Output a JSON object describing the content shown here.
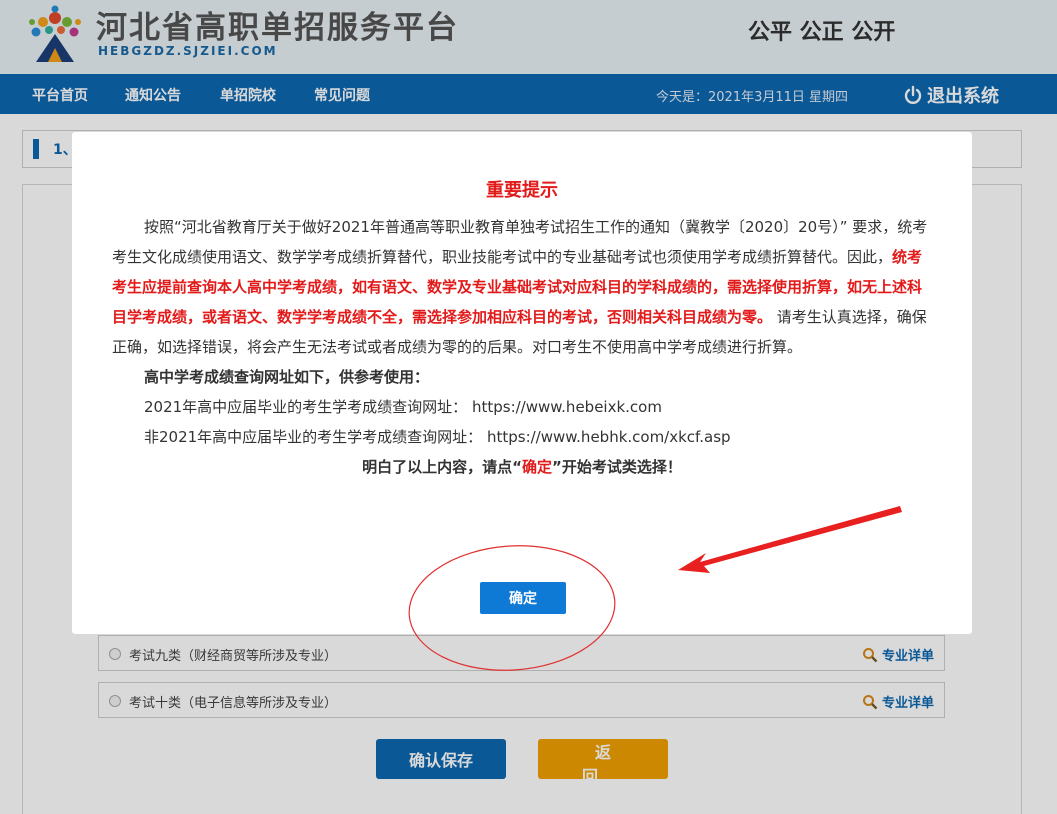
{
  "header": {
    "title": "河北省高职单招服务平台",
    "url": "HEBGZDZ.SJZIEI.COM",
    "slogan": "公平 公正 公开"
  },
  "nav": {
    "items": [
      "平台首页",
      "通知公告",
      "单招院校",
      "常见问题"
    ],
    "today": "今天是：2021年3月11日 星期四",
    "logout": "退出系统"
  },
  "main": {
    "section_num": "1、",
    "options": [
      {
        "label": "考试九类（财经商贸等所涉及专业）",
        "detail": "专业详单"
      },
      {
        "label": "考试十类（电子信息等所涉及专业）",
        "detail": "专业详单"
      }
    ],
    "save_label": "确认保存",
    "back_label": "返 回"
  },
  "modal": {
    "title": "重要提示",
    "p1_text": "按照“河北省教育厅关于做好2021年普通高等职业教育单独考试招生工作的通知（冀教学〔2020〕20号）” 要求，统考考生文化成绩使用语文、数学学考成绩折算替代，职业技能考试中的专业基础考试也须使用学考成绩折算替代。因此，",
    "p1_red": "统考考生应提前查询本人高中学考成绩，如有语文、数学及专业基础考试对应科目的学科成绩的，需选择使用折算，如无上述科目学考成绩，或者语文、数学学考成绩不全，需选择参加相应科目的考试，否则相关科目成绩为零。",
    "p1_tail": "请考生认真选择，确保正确，如选择错误，将会产生无法考试或者成绩为零的的后果。对口考生不使用高中学考成绩进行折算。",
    "query_heading": "高中学考成绩查询网址如下，供参考使用：",
    "query_line1_label": "2021年高中应届毕业的考生学考成绩查询网址：",
    "query_line1_url": "https://www.hebeixk.com",
    "query_line2_label": "非2021年高中应届毕业的考生学考成绩查询网址：",
    "query_line2_url": "https://www.hebhk.com/xkcf.asp",
    "confirm_pre": "明白了以上内容，请点“",
    "confirm_key": "确定",
    "confirm_post": "”开始考试类选择！",
    "ok_label": "确定"
  },
  "colors": {
    "nav_blue": "#0e68b2",
    "alert_red": "#e21a1a",
    "ok_blue": "#0e7ad6",
    "back_orange": "#f0a000"
  }
}
